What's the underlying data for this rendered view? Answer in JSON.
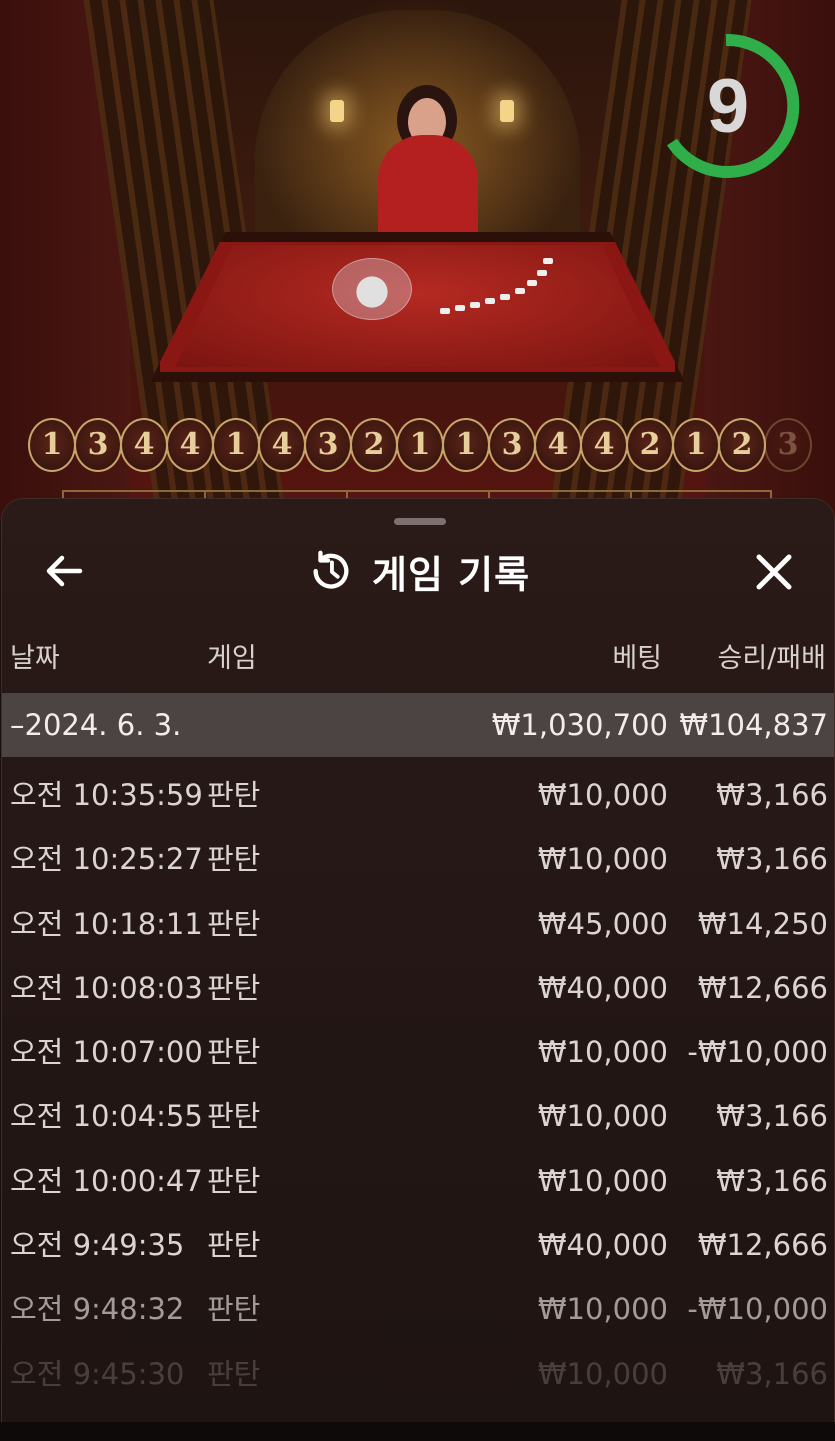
{
  "video": {
    "timer_value": "9",
    "timer_color": "#2fae4a",
    "roadmap": [
      "1",
      "3",
      "4",
      "4",
      "1",
      "4",
      "3",
      "2",
      "1",
      "1",
      "3",
      "4",
      "4",
      "2",
      "1",
      "2",
      "3"
    ]
  },
  "panel": {
    "title": "게임 기록",
    "title_icon": "history-icon",
    "back_icon": "arrow-left-icon",
    "close_icon": "close-icon",
    "columns": {
      "date": "날짜",
      "game": "게임",
      "bet": "베팅",
      "winloss": "승리/패배"
    },
    "date_group": {
      "date": "–2024. 6. 3.",
      "bet_total": "₩1,030,700",
      "win_total": "₩104,837"
    },
    "rows": [
      {
        "time": "오전 10:35:59",
        "game": "판탄",
        "bet": "₩10,000",
        "result": "₩3,166"
      },
      {
        "time": "오전 10:25:27",
        "game": "판탄",
        "bet": "₩10,000",
        "result": "₩3,166"
      },
      {
        "time": "오전 10:18:11",
        "game": "판탄",
        "bet": "₩45,000",
        "result": "₩14,250"
      },
      {
        "time": "오전 10:08:03",
        "game": "판탄",
        "bet": "₩40,000",
        "result": "₩12,666"
      },
      {
        "time": "오전 10:07:00",
        "game": "판탄",
        "bet": "₩10,000",
        "result": "-₩10,000"
      },
      {
        "time": "오전 10:04:55",
        "game": "판탄",
        "bet": "₩10,000",
        "result": "₩3,166"
      },
      {
        "time": "오전 10:00:47",
        "game": "판탄",
        "bet": "₩10,000",
        "result": "₩3,166"
      },
      {
        "time": "오전 9:49:35",
        "game": "판탄",
        "bet": "₩40,000",
        "result": "₩12,666"
      },
      {
        "time": "오전 9:48:32",
        "game": "판탄",
        "bet": "₩10,000",
        "result": "-₩10,000"
      },
      {
        "time": "오전 9:45:30",
        "game": "판탄",
        "bet": "₩10,000",
        "result": "₩3,166"
      }
    ]
  }
}
